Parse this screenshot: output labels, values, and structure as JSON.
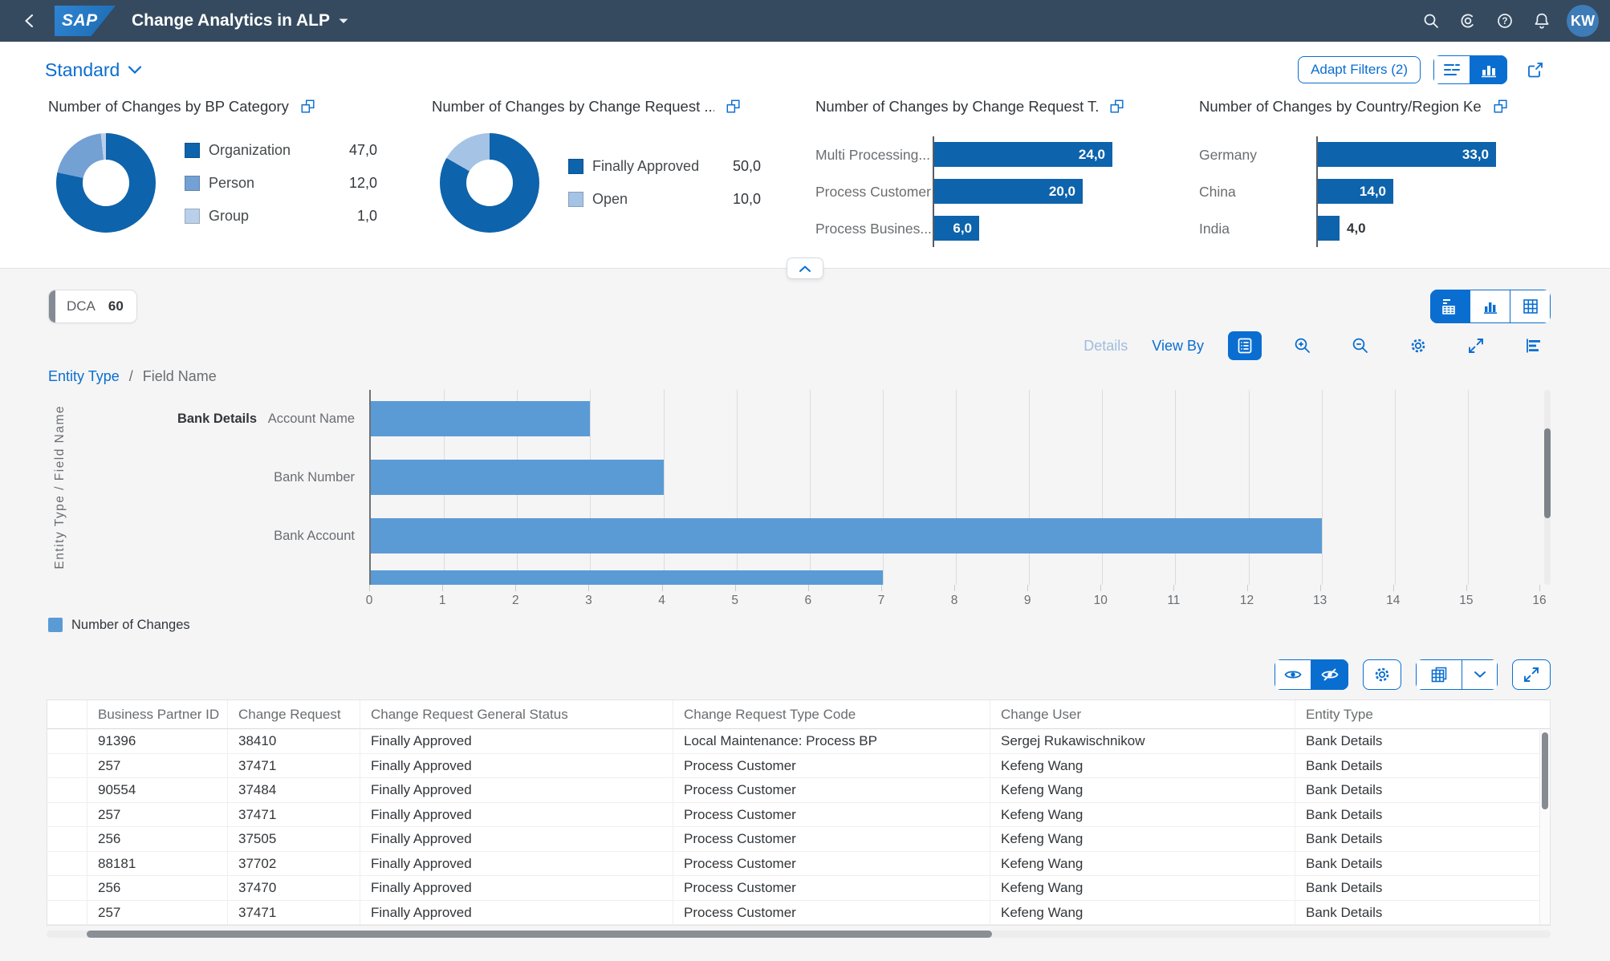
{
  "colors": {
    "accent": "#0a6ed1",
    "shell_bg": "#354a5f",
    "chart_bar": "#5b9bd5",
    "kpi_dark": "#0d63ac"
  },
  "shell": {
    "logo_text": "SAP",
    "title": "Change Analytics in ALP",
    "avatar": "KW"
  },
  "filter_bar": {
    "variant_label": "Standard",
    "adapt_filters": "Adapt Filters (2)"
  },
  "kpi_cards": [
    {
      "type": "donut",
      "title": "Number of Changes by BP Category",
      "slices": [
        {
          "label": "Organization",
          "value": "47,0",
          "num": 47,
          "color": "#0d63ac"
        },
        {
          "label": "Person",
          "value": "12,0",
          "num": 12,
          "color": "#74a1d4"
        },
        {
          "label": "Group",
          "value": "1,0",
          "num": 1,
          "color": "#bad0ea"
        }
      ]
    },
    {
      "type": "donut",
      "title": "Number of Changes by Change Request ...",
      "slices": [
        {
          "label": "Finally Approved",
          "value": "50,0",
          "num": 50,
          "color": "#0d63ac"
        },
        {
          "label": "Open",
          "value": "10,0",
          "num": 10,
          "color": "#a5c3e4"
        }
      ]
    },
    {
      "type": "hbar",
      "title": "Number of Changes by Change Request T...",
      "color": "#0d63ac",
      "bars": [
        {
          "label": "Multi Processing...",
          "value": "24,0",
          "num": 24
        },
        {
          "label": "Process Customer",
          "value": "20,0",
          "num": 20
        },
        {
          "label": "Process Busines...",
          "value": "6,0",
          "num": 6
        }
      ]
    },
    {
      "type": "hbar",
      "title": "Number of Changes by Country/Region Key",
      "color": "#0d63ac",
      "bars": [
        {
          "label": "Germany",
          "value": "33,0",
          "num": 33
        },
        {
          "label": "China",
          "value": "14,0",
          "num": 14
        },
        {
          "label": "India",
          "value": "4,0",
          "num": 4
        }
      ]
    }
  ],
  "content": {
    "chip": {
      "label": "DCA",
      "count": "60"
    },
    "chart": {
      "toolbar": {
        "details": "Details",
        "view_by": "View By"
      },
      "breadcrumb": {
        "link": "Entity Type",
        "separator": "/",
        "current": "Field Name"
      },
      "y_axis_title": "Entity Type / Field Name",
      "group_label": "Bank Details",
      "bars": [
        {
          "label": "Account Name",
          "value": 3
        },
        {
          "label": "Bank Number",
          "value": 4
        },
        {
          "label": "Bank Account",
          "value": 13
        }
      ],
      "partial_bar": {
        "value": 7
      },
      "x_max": 16,
      "x_ticks": [
        0,
        1,
        2,
        3,
        4,
        5,
        6,
        7,
        8,
        9,
        10,
        11,
        12,
        13,
        14,
        15,
        16
      ],
      "legend_label": "Number of Changes",
      "bar_color": "#5b9bd5"
    },
    "table": {
      "columns": [
        "Business Partner ID",
        "Change Request",
        "Change Request General Status",
        "Change Request Type Code",
        "Change User",
        "Entity Type"
      ],
      "rows": [
        [
          "91396",
          "38410",
          "Finally Approved",
          "Local Maintenance: Process BP",
          "Sergej Rukawischnikow",
          "Bank Details"
        ],
        [
          "257",
          "37471",
          "Finally Approved",
          "Process Customer",
          "Kefeng Wang",
          "Bank Details"
        ],
        [
          "90554",
          "37484",
          "Finally Approved",
          "Process Customer",
          "Kefeng Wang",
          "Bank Details"
        ],
        [
          "257",
          "37471",
          "Finally Approved",
          "Process Customer",
          "Kefeng Wang",
          "Bank Details"
        ],
        [
          "256",
          "37505",
          "Finally Approved",
          "Process Customer",
          "Kefeng Wang",
          "Bank Details"
        ],
        [
          "88181",
          "37702",
          "Finally Approved",
          "Process Customer",
          "Kefeng Wang",
          "Bank Details"
        ],
        [
          "256",
          "37470",
          "Finally Approved",
          "Process Customer",
          "Kefeng Wang",
          "Bank Details"
        ],
        [
          "257",
          "37471",
          "Finally Approved",
          "Process Customer",
          "Kefeng Wang",
          "Bank Details"
        ]
      ]
    }
  }
}
